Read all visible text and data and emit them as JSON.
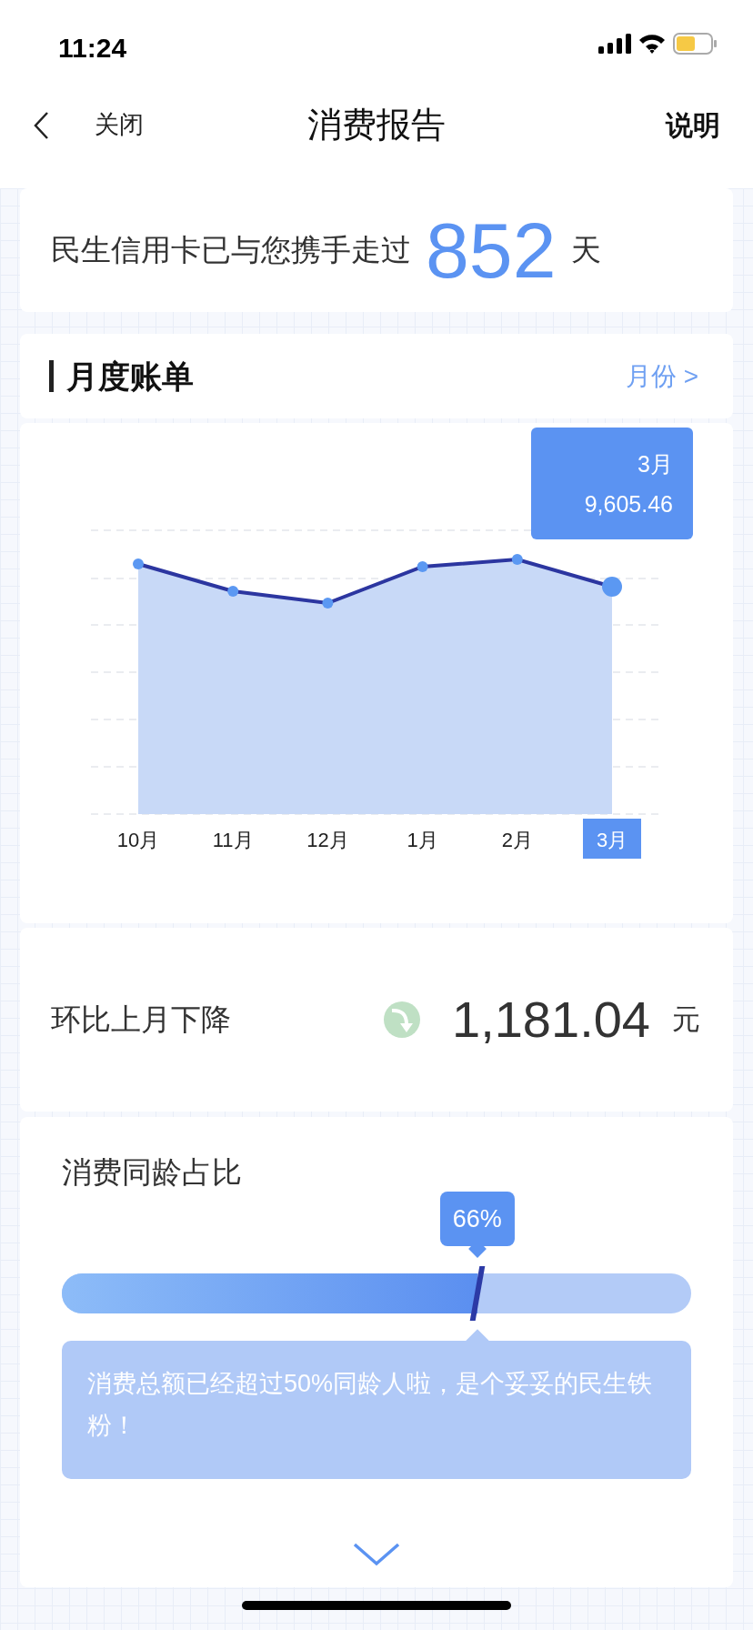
{
  "status_bar": {
    "time": "11:24"
  },
  "nav": {
    "back": "关闭",
    "title": "消费报告",
    "action": "说明"
  },
  "days_card": {
    "prefix": "民生信用卡已与您携手走过",
    "days": "852",
    "suffix": "天"
  },
  "monthly_bill": {
    "title": "月度账单",
    "link": "月份 >",
    "tooltip": {
      "month": "3月",
      "amount": "9,605.46"
    },
    "months": [
      {
        "label": "10月",
        "selected": false
      },
      {
        "label": "11月",
        "selected": false
      },
      {
        "label": "12月",
        "selected": false
      },
      {
        "label": "1月",
        "selected": false
      },
      {
        "label": "2月",
        "selected": false
      },
      {
        "label": "3月",
        "selected": true
      }
    ]
  },
  "change": {
    "label": "环比上月下降",
    "amount": "1,181.04",
    "unit": "元"
  },
  "peer_ratio": {
    "title": "消费同龄占比",
    "badge": "66%",
    "level": 0.66,
    "message": "消费总额已经超过50%同龄人啦，是个妥妥的民生铁粉！"
  }
}
